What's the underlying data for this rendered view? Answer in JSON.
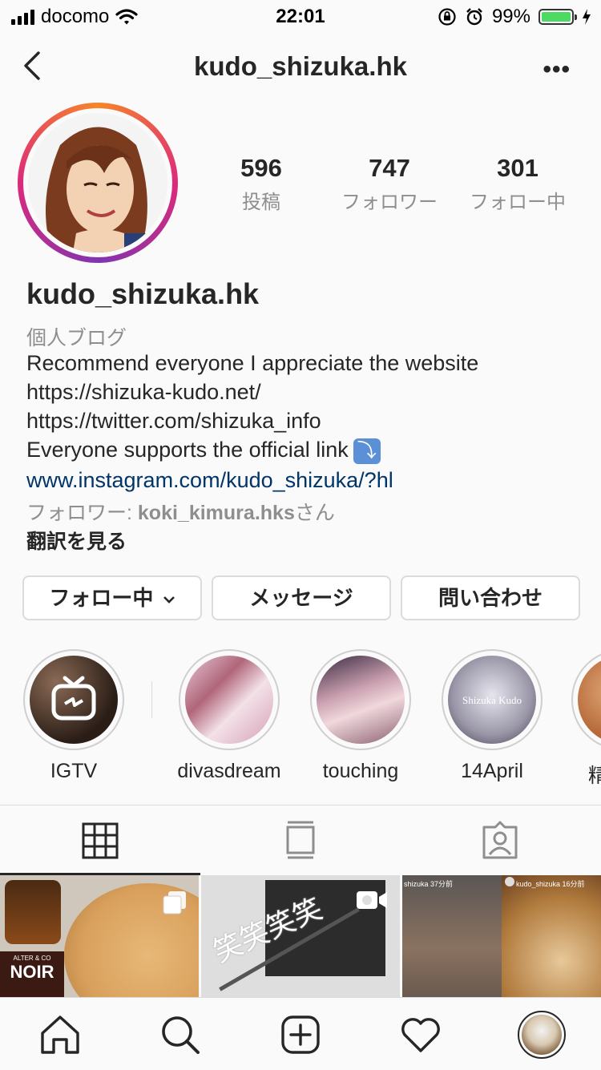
{
  "status_bar": {
    "carrier": "docomo",
    "time": "22:01",
    "battery": "99%",
    "battery_level": 0.99
  },
  "nav": {
    "title": "kudo_shizuka.hk",
    "back_icon": "chevron-left-icon",
    "more_icon": "more-dots-icon",
    "more_label": "•••"
  },
  "profile": {
    "username": "kudo_shizuka.hk",
    "stats": [
      {
        "value": "596",
        "label": "投稿"
      },
      {
        "value": "747",
        "label": "フォロワー"
      },
      {
        "value": "301",
        "label": "フォロー中"
      }
    ],
    "category": "個人ブログ",
    "bio_lines": [
      "Recommend everyone I appreciate the website",
      "https://shizuka-kudo.net/",
      "https://twitter.com/shizuka_info",
      "Everyone supports the official link"
    ],
    "bio_emoji": "⤵",
    "website": "www.instagram.com/kudo_shizuka/?hl",
    "followed_by_prefix": "フォロワー: ",
    "followed_by_user": "koki_kimura.hks",
    "followed_by_suffix": "さん",
    "translate": "翻訳を見る"
  },
  "buttons": {
    "following": "フォロー中",
    "message": "メッセージ",
    "contact": "問い合わせ"
  },
  "highlights": [
    {
      "label": "IGTV"
    },
    {
      "label": "divasdream"
    },
    {
      "label": "touching"
    },
    {
      "label": "14April",
      "overlay_text": "Shizuka Kudo"
    },
    {
      "label": "精"
    }
  ],
  "grid": {
    "tile2_overlay": "笑笑笑笑",
    "tile3_user": "shizuka 37分前",
    "tile4_user": "kudo_shizuka 16分前",
    "tile1_brand": "NOIR",
    "tile1_brand_top": "ALTER & CO"
  },
  "colors": {
    "accent_link": "#003569",
    "secondary_text": "#8e8e8e",
    "battery_green": "#4cd964"
  }
}
